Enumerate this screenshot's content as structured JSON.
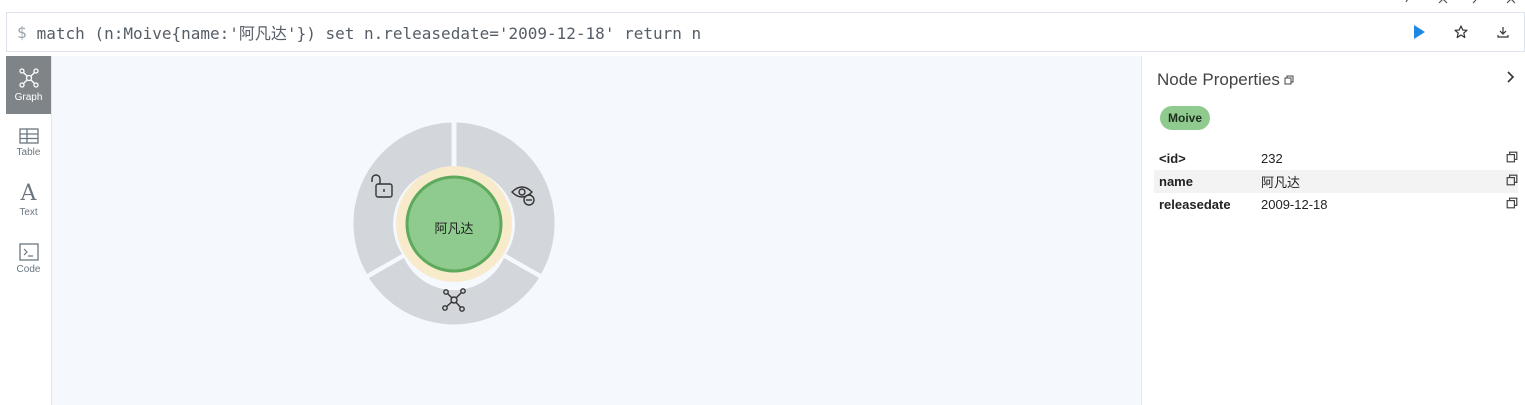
{
  "window_controls": [
    "pin-icon",
    "close-icon",
    "shrink-icon",
    "close-icon"
  ],
  "editor": {
    "prompt": "$",
    "query": "match (n:Moive{name:'阿凡达'}) set n.releasedate='2009-12-18' return n",
    "run_icon": "play-icon",
    "favorite_icon": "star-icon",
    "download_icon": "download-icon",
    "accent_color": "#1e88e5"
  },
  "sidebar": {
    "tabs": [
      {
        "label": "Graph",
        "icon": "graph-icon",
        "active": true
      },
      {
        "label": "Table",
        "icon": "table-icon",
        "active": false
      },
      {
        "label": "Text",
        "icon": "text-icon",
        "active": false
      },
      {
        "label": "Code",
        "icon": "code-icon",
        "active": false
      }
    ]
  },
  "graph": {
    "node_caption": "阿凡达",
    "node_color": "#8fcb8e",
    "node_border": "#5daa5c",
    "halo_color": "#f7ebcc",
    "ring_menu": [
      "unlock-icon",
      "hide-icon",
      "expand-relationships-icon"
    ]
  },
  "panel": {
    "title": "Node Properties",
    "label": "Moive",
    "properties": [
      {
        "key": "<id>",
        "value": "232"
      },
      {
        "key": "name",
        "value": "阿凡达"
      },
      {
        "key": "releasedate",
        "value": "2009-12-18"
      }
    ]
  }
}
